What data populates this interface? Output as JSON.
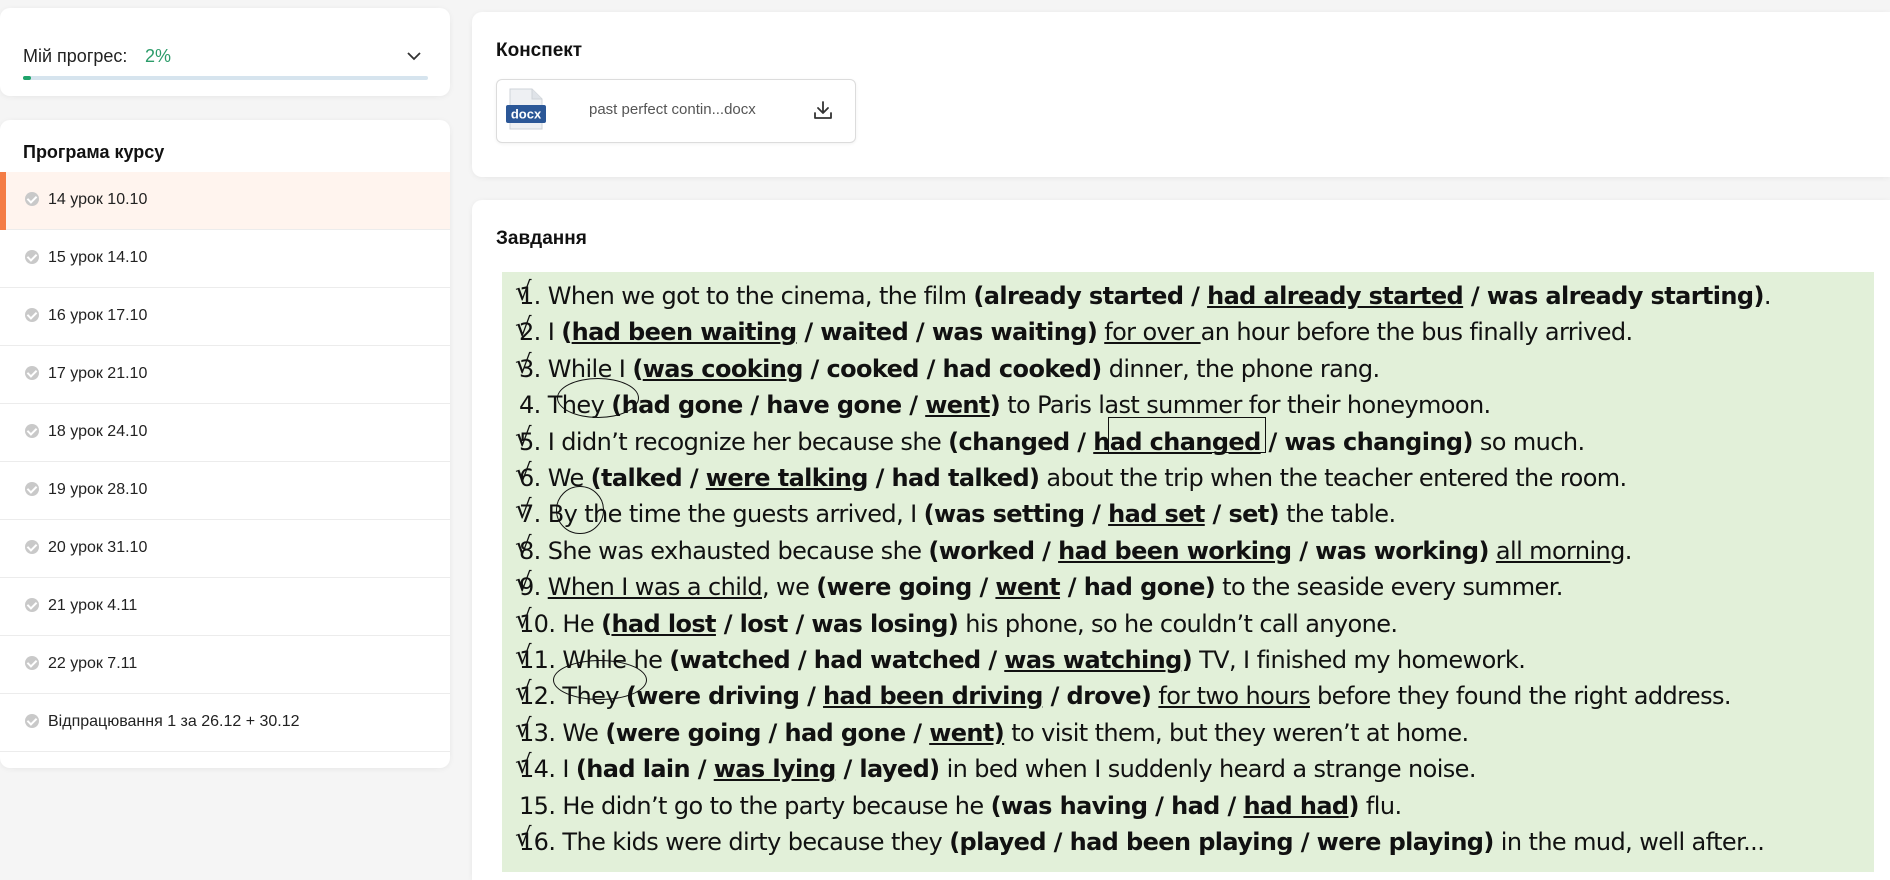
{
  "progress": {
    "label": "Мій прогрес:",
    "value": "2%",
    "fraction": 0.02,
    "accent": "#1fa36a"
  },
  "program": {
    "title": "Програма курсу",
    "items": [
      {
        "label": "14 урок 10.10",
        "active": true
      },
      {
        "label": "15 урок 14.10",
        "active": false
      },
      {
        "label": "16 урок 17.10",
        "active": false
      },
      {
        "label": "17 урок 21.10",
        "active": false
      },
      {
        "label": "18 урок 24.10",
        "active": false
      },
      {
        "label": "19 урок 28.10",
        "active": false
      },
      {
        "label": "20 урок 31.10",
        "active": false
      },
      {
        "label": "21 урок 4.11",
        "active": false
      },
      {
        "label": "22 урок 7.11",
        "active": false
      },
      {
        "label": "Відпрацювання 1 за 26.12 + 30.12",
        "active": false
      }
    ]
  },
  "summary": {
    "title": "Конспект",
    "file": {
      "name": "past perfect contin...docx",
      "icon_label": "docx",
      "icon": "docx-file-icon",
      "download_icon": "download-icon"
    }
  },
  "tasks": {
    "title": "Завдання",
    "lines": [
      {
        "n": "1.",
        "tick": true,
        "parts": [
          {
            "t": "When we got to the cinema, the film "
          },
          {
            "t": "(already started / ",
            "b": true
          },
          {
            "t": "had already started",
            "b": true,
            "u": true
          },
          {
            "t": " / was already starting)",
            "b": true
          },
          {
            "t": "."
          }
        ]
      },
      {
        "n": "2.",
        "tick": true,
        "parts": [
          {
            "t": "I "
          },
          {
            "t": "(",
            "b": true
          },
          {
            "t": "had been waiting",
            "b": true,
            "u": true
          },
          {
            "t": " / waited / was waiting)",
            "b": true
          },
          {
            "t": " "
          },
          {
            "t": "for over ",
            "u": true
          },
          {
            "t": "an hour before the bus finally arrived."
          }
        ]
      },
      {
        "n": "3.",
        "tick": true,
        "parts": [
          {
            "t": "While I "
          },
          {
            "t": "(",
            "b": true
          },
          {
            "t": "was cooking",
            "b": true,
            "u": true
          },
          {
            "t": " / cooked / had cooked)",
            "b": true
          },
          {
            "t": " dinner, the phone rang."
          }
        ]
      },
      {
        "n": "4.",
        "tick": false,
        "parts": [
          {
            "t": "They "
          },
          {
            "t": "(had gone / have gone / ",
            "b": true
          },
          {
            "t": "went",
            "b": true,
            "u": true
          },
          {
            "t": ")",
            "b": true
          },
          {
            "t": " to Paris "
          },
          {
            "t": "last summer "
          },
          {
            "t": "for their honeymoon."
          }
        ]
      },
      {
        "n": "5.",
        "tick": true,
        "parts": [
          {
            "t": "I didn’t recognize her because she "
          },
          {
            "t": "(changed / ",
            "b": true
          },
          {
            "t": "had changed",
            "b": true,
            "u": true
          },
          {
            "t": " / was changing)",
            "b": true
          },
          {
            "t": " so much."
          }
        ]
      },
      {
        "n": "6.",
        "tick": true,
        "parts": [
          {
            "t": "We "
          },
          {
            "t": "(talked / ",
            "b": true
          },
          {
            "t": "were talking",
            "b": true,
            "u": true
          },
          {
            "t": " / had talked)",
            "b": true
          },
          {
            "t": " about the trip when the teacher entered the room."
          }
        ]
      },
      {
        "n": "7.",
        "tick": true,
        "parts": [
          {
            "t": "By the time the guests arrived, I "
          },
          {
            "t": "(was setting / ",
            "b": true
          },
          {
            "t": "had set",
            "b": true,
            "u": true
          },
          {
            "t": " / set)",
            "b": true
          },
          {
            "t": " the table."
          }
        ]
      },
      {
        "n": "8.",
        "tick": true,
        "parts": [
          {
            "t": "She was exhausted because she "
          },
          {
            "t": "(worked / ",
            "b": true
          },
          {
            "t": "had been working",
            "b": true,
            "u": true
          },
          {
            "t": " / was working)",
            "b": true
          },
          {
            "t": " "
          },
          {
            "t": "all morning",
            "u": true
          },
          {
            "t": "."
          }
        ]
      },
      {
        "n": "9.",
        "tick": true,
        "parts": [
          {
            "t": "When I was a child",
            "u": true
          },
          {
            "t": ", we "
          },
          {
            "t": "(were going / ",
            "b": true
          },
          {
            "t": "went",
            "b": true,
            "u": true
          },
          {
            "t": " / had gone)",
            "b": true
          },
          {
            "t": " to the seaside every summer."
          }
        ]
      },
      {
        "n": "10.",
        "tick": true,
        "parts": [
          {
            "t": "He "
          },
          {
            "t": "(",
            "b": true
          },
          {
            "t": "had lost",
            "b": true,
            "u": true
          },
          {
            "t": " / lost / was losing)",
            "b": true
          },
          {
            "t": " his phone, so he couldn’t call anyone."
          }
        ]
      },
      {
        "n": "11.",
        "tick": true,
        "parts": [
          {
            "t": "While he "
          },
          {
            "t": "(watched / had watched / ",
            "b": true
          },
          {
            "t": "was watching",
            "b": true,
            "u": true
          },
          {
            "t": ")",
            "b": true
          },
          {
            "t": " TV, I finished my homework."
          }
        ]
      },
      {
        "n": "12.",
        "tick": true,
        "parts": [
          {
            "t": "They "
          },
          {
            "t": "(were driving / ",
            "b": true
          },
          {
            "t": "had been driving",
            "b": true,
            "u": true
          },
          {
            "t": " / drove)",
            "b": true
          },
          {
            "t": " "
          },
          {
            "t": "for two hours",
            "u": true
          },
          {
            "t": " before they found the right address."
          }
        ]
      },
      {
        "n": "13.",
        "tick": true,
        "parts": [
          {
            "t": "We "
          },
          {
            "t": "(were going / had gone / ",
            "b": true
          },
          {
            "t": "went)",
            "b": true,
            "u": true
          },
          {
            "t": " to visit them, but they weren’t at home."
          }
        ]
      },
      {
        "n": "14.",
        "tick": true,
        "parts": [
          {
            "t": "I "
          },
          {
            "t": "(had lain / ",
            "b": true
          },
          {
            "t": "was lying",
            "b": true,
            "u": true
          },
          {
            "t": " / layed)",
            "b": true
          },
          {
            "t": " in bed when I suddenly heard a strange noise."
          }
        ]
      },
      {
        "n": "15.",
        "tick": false,
        "parts": [
          {
            "t": "He didn’t go to the party because he "
          },
          {
            "t": "(was having / had / ",
            "b": true
          },
          {
            "t": "had had",
            "b": true,
            "u": true
          },
          {
            "t": ")",
            "b": true
          },
          {
            "t": " flu."
          }
        ]
      },
      {
        "n": "16.",
        "tick": true,
        "parts": [
          {
            "t": "The kids were dirty because they "
          },
          {
            "t": "(played / had been playing / were playing)",
            "b": true
          },
          {
            "t": " in the mud, well after..."
          }
        ]
      }
    ]
  }
}
